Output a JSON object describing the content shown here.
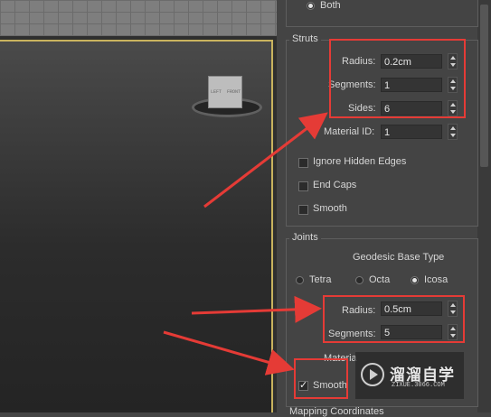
{
  "top_option": {
    "label": "Both",
    "selected": true
  },
  "struts": {
    "title": "Struts",
    "radius": {
      "label": "Radius:",
      "value": "0.2cm"
    },
    "segments": {
      "label": "Segments:",
      "value": "1"
    },
    "sides": {
      "label": "Sides:",
      "value": "6"
    },
    "material_id": {
      "label": "Material ID:",
      "value": "1"
    },
    "ignore_hidden_edges": {
      "label": "Ignore Hidden Edges",
      "checked": false
    },
    "end_caps": {
      "label": "End Caps",
      "checked": false
    },
    "smooth": {
      "label": "Smooth",
      "checked": false
    }
  },
  "joints": {
    "title": "Joints",
    "base_type_label": "Geodesic Base Type",
    "base_types": [
      {
        "label": "Tetra",
        "selected": false
      },
      {
        "label": "Octa",
        "selected": false
      },
      {
        "label": "Icosa",
        "selected": true
      }
    ],
    "radius": {
      "label": "Radius:",
      "value": "0.5cm"
    },
    "segments": {
      "label": "Segments:",
      "value": "5"
    },
    "material_label": "Materia",
    "smooth": {
      "label": "Smooth",
      "checked": true
    }
  },
  "next_section_title": "Mapping Coordinates",
  "viewcube": {
    "face_labels": [
      "LEFT",
      "FRONT"
    ]
  },
  "watermark": {
    "title": "溜溜自学",
    "url": "ZIXUE.3066.COM"
  },
  "colors": {
    "highlight": "#e53b36",
    "viewport_border": "#c9b35e",
    "panel_bg": "#444444"
  }
}
